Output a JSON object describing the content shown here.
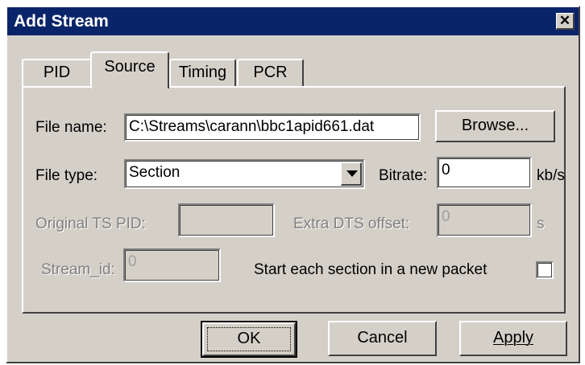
{
  "window": {
    "title": "Add Stream",
    "close_label": "✕"
  },
  "tabs": [
    {
      "label": "PID"
    },
    {
      "label": "Source"
    },
    {
      "label": "Timing"
    },
    {
      "label": "PCR"
    }
  ],
  "active_tab": "Source",
  "source": {
    "file_name_label": "File name:",
    "file_name_value": "C:\\Streams\\carann\\bbc1apid661.dat",
    "browse_label": "Browse...",
    "file_type_label": "File type:",
    "file_type_value": "Section",
    "bitrate_label": "Bitrate:",
    "bitrate_value": "0",
    "bitrate_unit": "kb/s",
    "original_ts_pid_label": "Original TS PID:",
    "original_ts_pid_value": "",
    "extra_dts_offset_label": "Extra DTS offset:",
    "extra_dts_offset_value": "0",
    "extra_dts_offset_unit": "s",
    "stream_id_label": "Stream_id:",
    "stream_id_value": "0",
    "start_each_section_label": "Start each section in a new packet",
    "start_each_section_checked": false
  },
  "buttons": {
    "ok_label": "OK",
    "cancel_label": "Cancel",
    "apply_label": "Apply"
  }
}
